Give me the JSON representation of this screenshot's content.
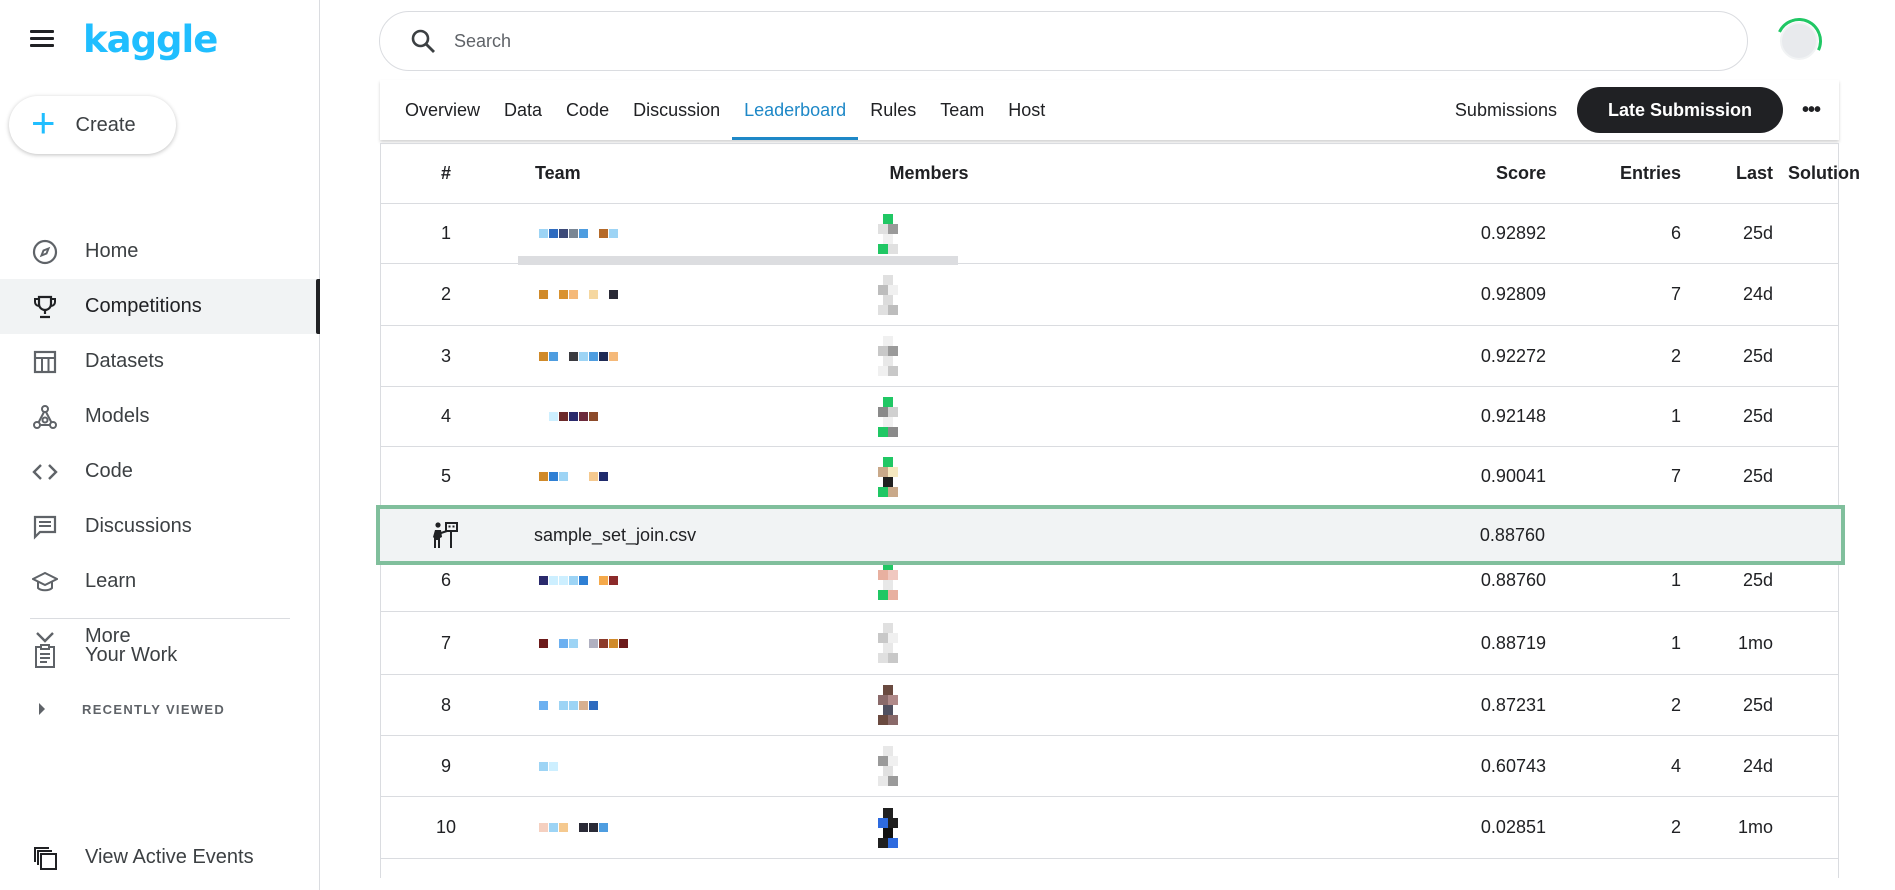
{
  "app": {
    "logo": "kaggle"
  },
  "sidebar": {
    "create_label": "Create",
    "items": [
      {
        "label": "Home",
        "icon": "compass-icon",
        "active": false
      },
      {
        "label": "Competitions",
        "icon": "trophy-icon",
        "active": true
      },
      {
        "label": "Datasets",
        "icon": "table-icon",
        "active": false
      },
      {
        "label": "Models",
        "icon": "models-icon",
        "active": false
      },
      {
        "label": "Code",
        "icon": "code-icon",
        "active": false
      },
      {
        "label": "Discussions",
        "icon": "discussion-icon",
        "active": false
      },
      {
        "label": "Learn",
        "icon": "school-icon",
        "active": false
      },
      {
        "label": "More",
        "icon": "chevron-down-icon",
        "active": false
      }
    ],
    "your_work": "Your Work",
    "recently_viewed": "RECENTLY VIEWED",
    "view_active_events": "View Active Events"
  },
  "search": {
    "placeholder": "Search"
  },
  "tabs": {
    "items": [
      "Overview",
      "Data",
      "Code",
      "Discussion",
      "Leaderboard",
      "Rules",
      "Team",
      "Host"
    ],
    "active": "Leaderboard",
    "submissions": "Submissions",
    "late_submission": "Late Submission"
  },
  "leaderboard": {
    "headers": {
      "rank": "#",
      "team": "Team",
      "members": "Members",
      "score": "Score",
      "entries": "Entries",
      "last": "Last",
      "solution": "Solution"
    },
    "highlight": {
      "file": "sample_set_join.csv",
      "score": "0.88760"
    },
    "rows": [
      {
        "rank": "1",
        "score": "0.92892",
        "entries": "6",
        "last": "25d"
      },
      {
        "rank": "2",
        "score": "0.92809",
        "entries": "7",
        "last": "24d"
      },
      {
        "rank": "3",
        "score": "0.92272",
        "entries": "2",
        "last": "25d"
      },
      {
        "rank": "4",
        "score": "0.92148",
        "entries": "1",
        "last": "25d"
      },
      {
        "rank": "5",
        "score": "0.90041",
        "entries": "7",
        "last": "25d"
      },
      {
        "rank": "6",
        "score": "0.88760",
        "entries": "1",
        "last": "25d"
      },
      {
        "rank": "7",
        "score": "0.88719",
        "entries": "1",
        "last": "1mo"
      },
      {
        "rank": "8",
        "score": "0.87231",
        "entries": "2",
        "last": "25d"
      },
      {
        "rank": "9",
        "score": "0.60743",
        "entries": "4",
        "last": "24d"
      },
      {
        "rank": "10",
        "score": "0.02851",
        "entries": "2",
        "last": "1mo"
      }
    ]
  },
  "colors": {
    "accent": "#20beff",
    "active_tab": "#1e88c7",
    "highlight_border": "#80bf9c"
  }
}
